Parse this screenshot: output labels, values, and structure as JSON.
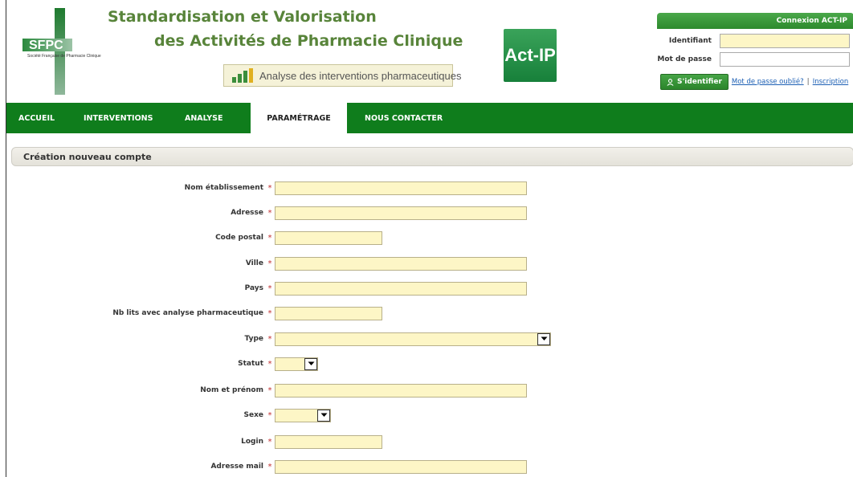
{
  "header": {
    "logo_text": "SFPC",
    "logo_subtitle": "Société Française de Pharmacie Clinique",
    "title_line1": "Standardisation et Valorisation",
    "title_line2": "des Activités de Pharmacie Clinique",
    "subtitle": "Analyse des interventions pharmaceutiques",
    "product_logo": "Act-IP"
  },
  "login": {
    "bar_title": "Connexion ACT-IP",
    "identifier_label": "Identifiant",
    "identifier_value": "",
    "password_label": "Mot de passe",
    "password_value": "",
    "submit_label": "S'identifier",
    "forgot_link": "Mot de passe oublié?",
    "separator": "|",
    "signup_link": "Inscription"
  },
  "nav": {
    "items": [
      {
        "label": "ACCUEIL",
        "active": false
      },
      {
        "label": "INTERVENTIONS",
        "active": false
      },
      {
        "label": "ANALYSE",
        "active": false
      },
      {
        "label": "PARAMÉTRAGE",
        "active": true
      },
      {
        "label": "NOUS CONTACTER",
        "active": false
      }
    ]
  },
  "section": {
    "title": "Création nouveau compte"
  },
  "form": {
    "required_marker": "*",
    "fields": [
      {
        "label": "Nom établissement",
        "kind": "text",
        "value": ""
      },
      {
        "label": "Adresse",
        "kind": "text",
        "value": ""
      },
      {
        "label": "Code postal",
        "kind": "text",
        "value": ""
      },
      {
        "label": "Ville",
        "kind": "text",
        "value": ""
      },
      {
        "label": "Pays",
        "kind": "text",
        "value": ""
      },
      {
        "label": "Nb lits avec analyse pharmaceutique",
        "kind": "text",
        "value": ""
      },
      {
        "label": "Type",
        "kind": "select",
        "value": ""
      },
      {
        "label": "Statut",
        "kind": "select",
        "value": ""
      },
      {
        "label": "Nom et prénom",
        "kind": "text",
        "value": ""
      },
      {
        "label": "Sexe",
        "kind": "select",
        "value": ""
      },
      {
        "label": "Login",
        "kind": "text",
        "value": ""
      },
      {
        "label": "Adresse mail",
        "kind": "text",
        "value": ""
      }
    ]
  },
  "colors": {
    "brand_green": "#0f7d1c",
    "title_green": "#58843a",
    "field_yellow": "#fdf6c6",
    "required_red": "#c23030",
    "link_blue": "#1c5fb4"
  }
}
